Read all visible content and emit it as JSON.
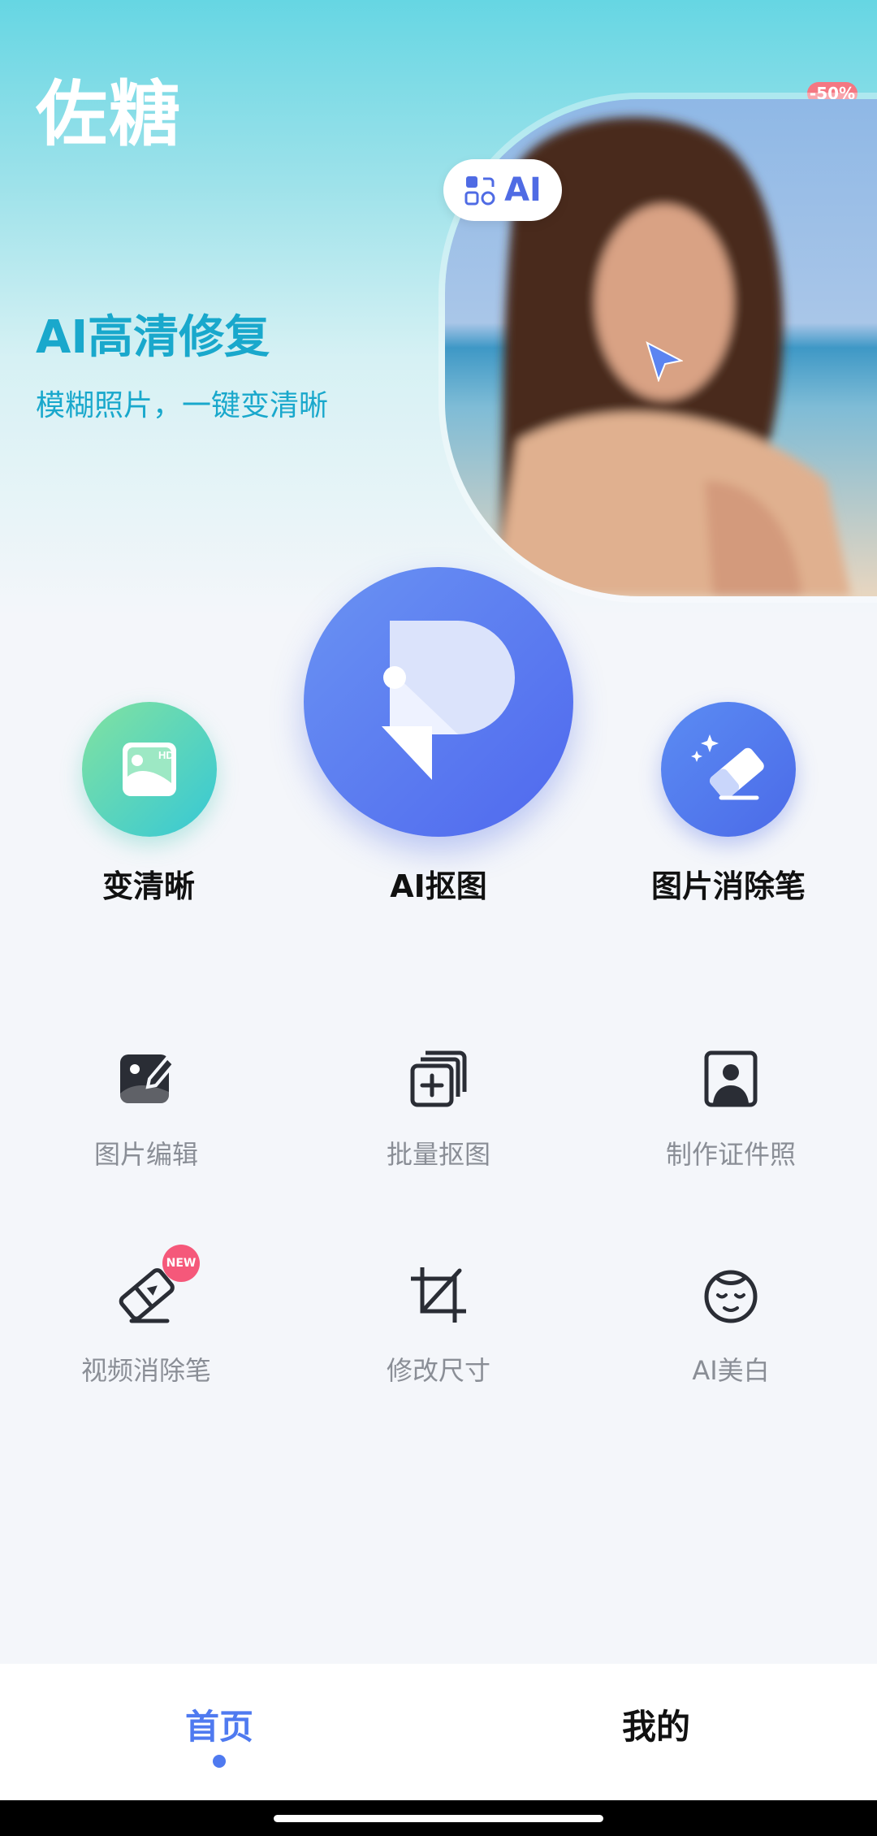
{
  "app": {
    "title": "佐糖"
  },
  "hero": {
    "title": "AI高清修复",
    "subtitle": "模糊照片，一键变清晰",
    "badge": "-50%",
    "ai_pill": "AI"
  },
  "main_features": [
    {
      "label": "变清晰",
      "icon": "hd-image-icon"
    },
    {
      "label": "AI抠图",
      "icon": "app-logo-icon"
    },
    {
      "label": "图片消除笔",
      "icon": "eraser-sparkle-icon"
    }
  ],
  "tools": [
    {
      "label": "图片编辑",
      "icon": "image-edit-icon"
    },
    {
      "label": "批量抠图",
      "icon": "batch-cutout-icon"
    },
    {
      "label": "制作证件照",
      "icon": "id-photo-icon"
    },
    {
      "label": "视频消除笔",
      "icon": "video-eraser-icon",
      "badge": "NEW"
    },
    {
      "label": "修改尺寸",
      "icon": "crop-icon"
    },
    {
      "label": "AI美白",
      "icon": "face-whitening-icon"
    }
  ],
  "tabbar": {
    "home": "首页",
    "me": "我的"
  },
  "colors": {
    "accent": "#4f7af0",
    "hero_text": "#19a8cc",
    "badge": "#f5587a"
  }
}
